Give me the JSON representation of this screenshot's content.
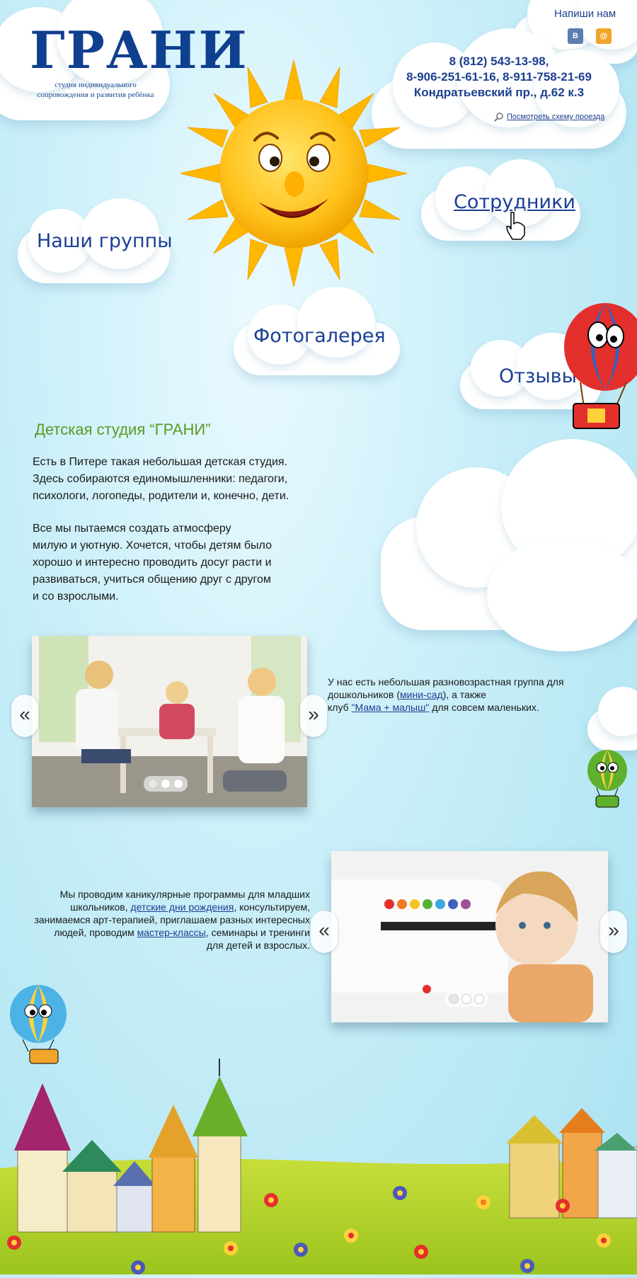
{
  "header": {
    "logo_title": "ГРАНИ",
    "logo_subtitle_line1": "студия индивидуального",
    "logo_subtitle_line2": "сопровождения и развития ребёнка",
    "write_us": "Напиши нам",
    "social": [
      {
        "name": "vk-icon",
        "glyph": "В",
        "color": "#5a7fb0"
      },
      {
        "name": "mail-icon",
        "glyph": "@",
        "color": "#f0a52a"
      }
    ],
    "phone1": "8 (812) 543-13-98,",
    "phone2": "8-906-251-61-16, 8-911-758-21-69",
    "address": "Кондратьевский пр., д.62 к.3",
    "map_link": "Посмотреть схему проезда"
  },
  "nav": {
    "groups": "Наши группы",
    "staff": "Сотрудники",
    "gallery": "Фотогалерея",
    "reviews": "Отзывы"
  },
  "intro": {
    "heading": "Детская студия “ГРАНИ”",
    "p1_line1": "Есть в Питере такая небольшая детская студия.",
    "p1_line2": "Здесь собираются единомышленники: педагоги,",
    "p1_line3": "психологи, логопеды, родители и, конечно, дети.",
    "p2_line1": "Все мы пытаемся создать атмосферу",
    "p2_line2": "милую и уютную. Хочется, чтобы детям было",
    "p2_line3": "хорошо и интересно проводить досуг расти и",
    "p2_line4": "развиваться, учиться общению друг с другом",
    "p2_line5": "и со взрослыми."
  },
  "block1": {
    "t1": "У нас есть небольшая разновозрастная группа для",
    "t2a": "дошкольников (",
    "link1": "мини-сад",
    "t2b": "), а также",
    "t3a": "клуб ",
    "link2": "\"Мама + малыш\"",
    "t3b": " для совсем маленьких."
  },
  "block2": {
    "t1": "Мы проводим каникулярные программы для младших",
    "t2a": "школьников, ",
    "link1": "детские дни рождения",
    "t2b": ", консультируем,",
    "t3": "занимаемся арт-терапией, приглашаем разных интересных",
    "t4a": "людей, проводим ",
    "link2": "мастер-классы",
    "t4b": ", семинары и тренинги",
    "t5": "для детей и взрослых."
  },
  "slider": {
    "prev": "«",
    "next": "»"
  },
  "colors": {
    "accent_blue": "#1b3e94",
    "heading_green": "#5a9b25",
    "grass": "#b6d52a"
  }
}
